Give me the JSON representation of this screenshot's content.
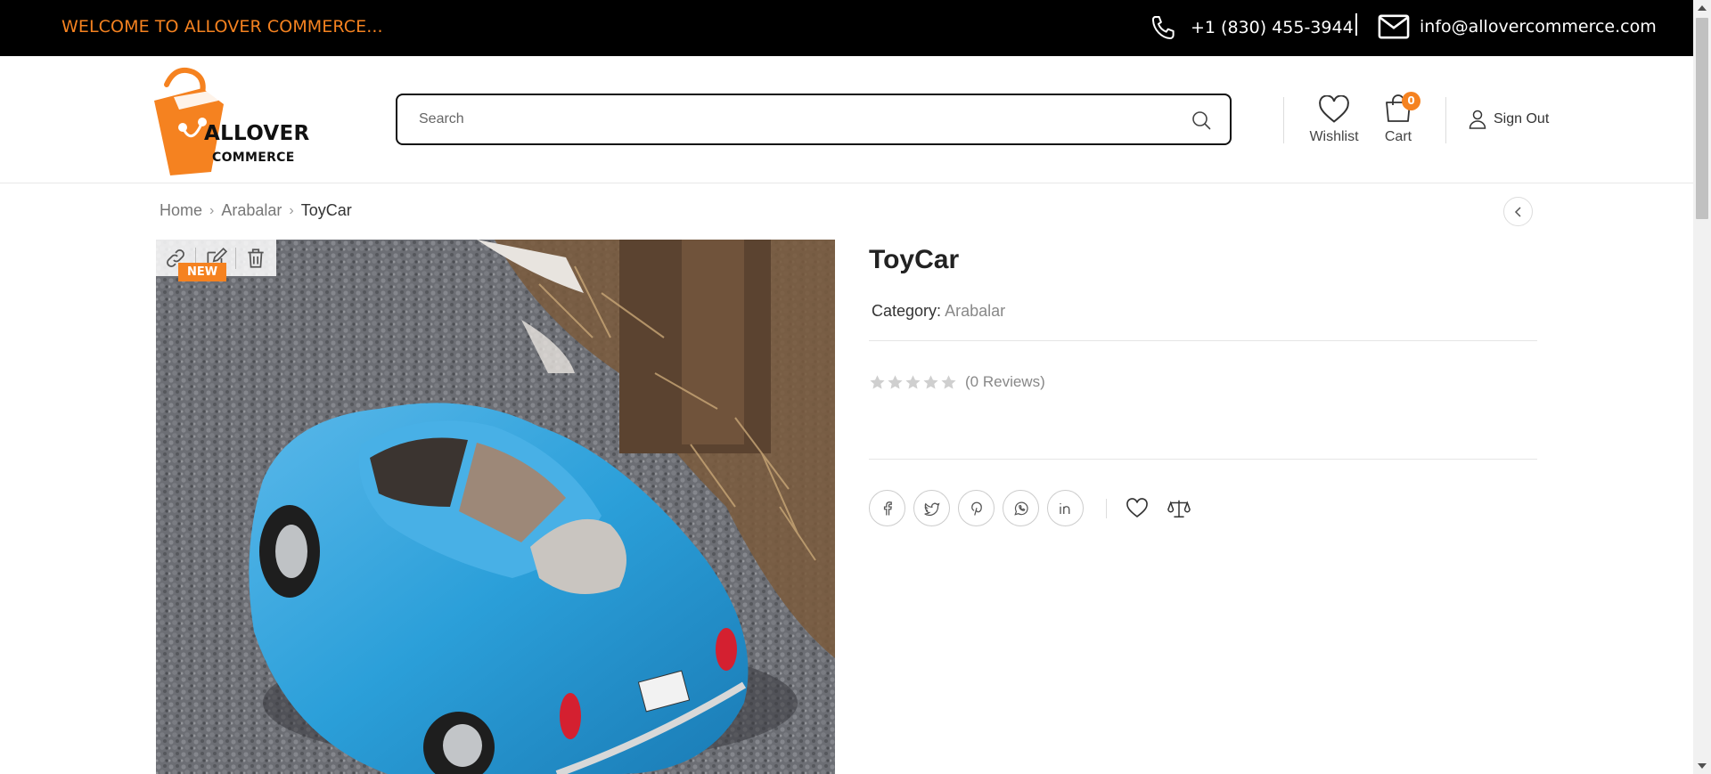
{
  "topbar": {
    "welcome": "WELCOME TO ALLOVER COMMERCE...",
    "phone": "+1 (830) 455-3944",
    "email": "info@allovercommerce.com",
    "phone_icon": "phone-icon",
    "mail_icon": "mail-icon"
  },
  "header": {
    "logo": {
      "line1": "ALLOVER",
      "line2": "COMMERCE"
    },
    "search": {
      "placeholder": "Search",
      "value": ""
    },
    "wishlist_label": "Wishlist",
    "cart_label": "Cart",
    "cart_count": "0",
    "signout_label": "Sign Out"
  },
  "breadcrumb": {
    "items": [
      "Home",
      "Arabalar"
    ],
    "current": "ToyCar"
  },
  "product": {
    "badge": "NEW",
    "title": "ToyCar",
    "category_label": "Category:",
    "category_value": "Arabalar",
    "rating": 0,
    "reviews": "(0 Reviews)"
  },
  "colors": {
    "accent": "#f58220",
    "topbar_bg": "#000000",
    "car_blue": "#2b9fd9"
  },
  "share_icons": [
    "facebook-icon",
    "twitter-icon",
    "pinterest-icon",
    "whatsapp-icon",
    "linkedin-icon"
  ],
  "action_icons": [
    "heart-icon",
    "compare-icon"
  ],
  "image_tools": [
    "link-icon",
    "edit-icon",
    "trash-icon"
  ]
}
